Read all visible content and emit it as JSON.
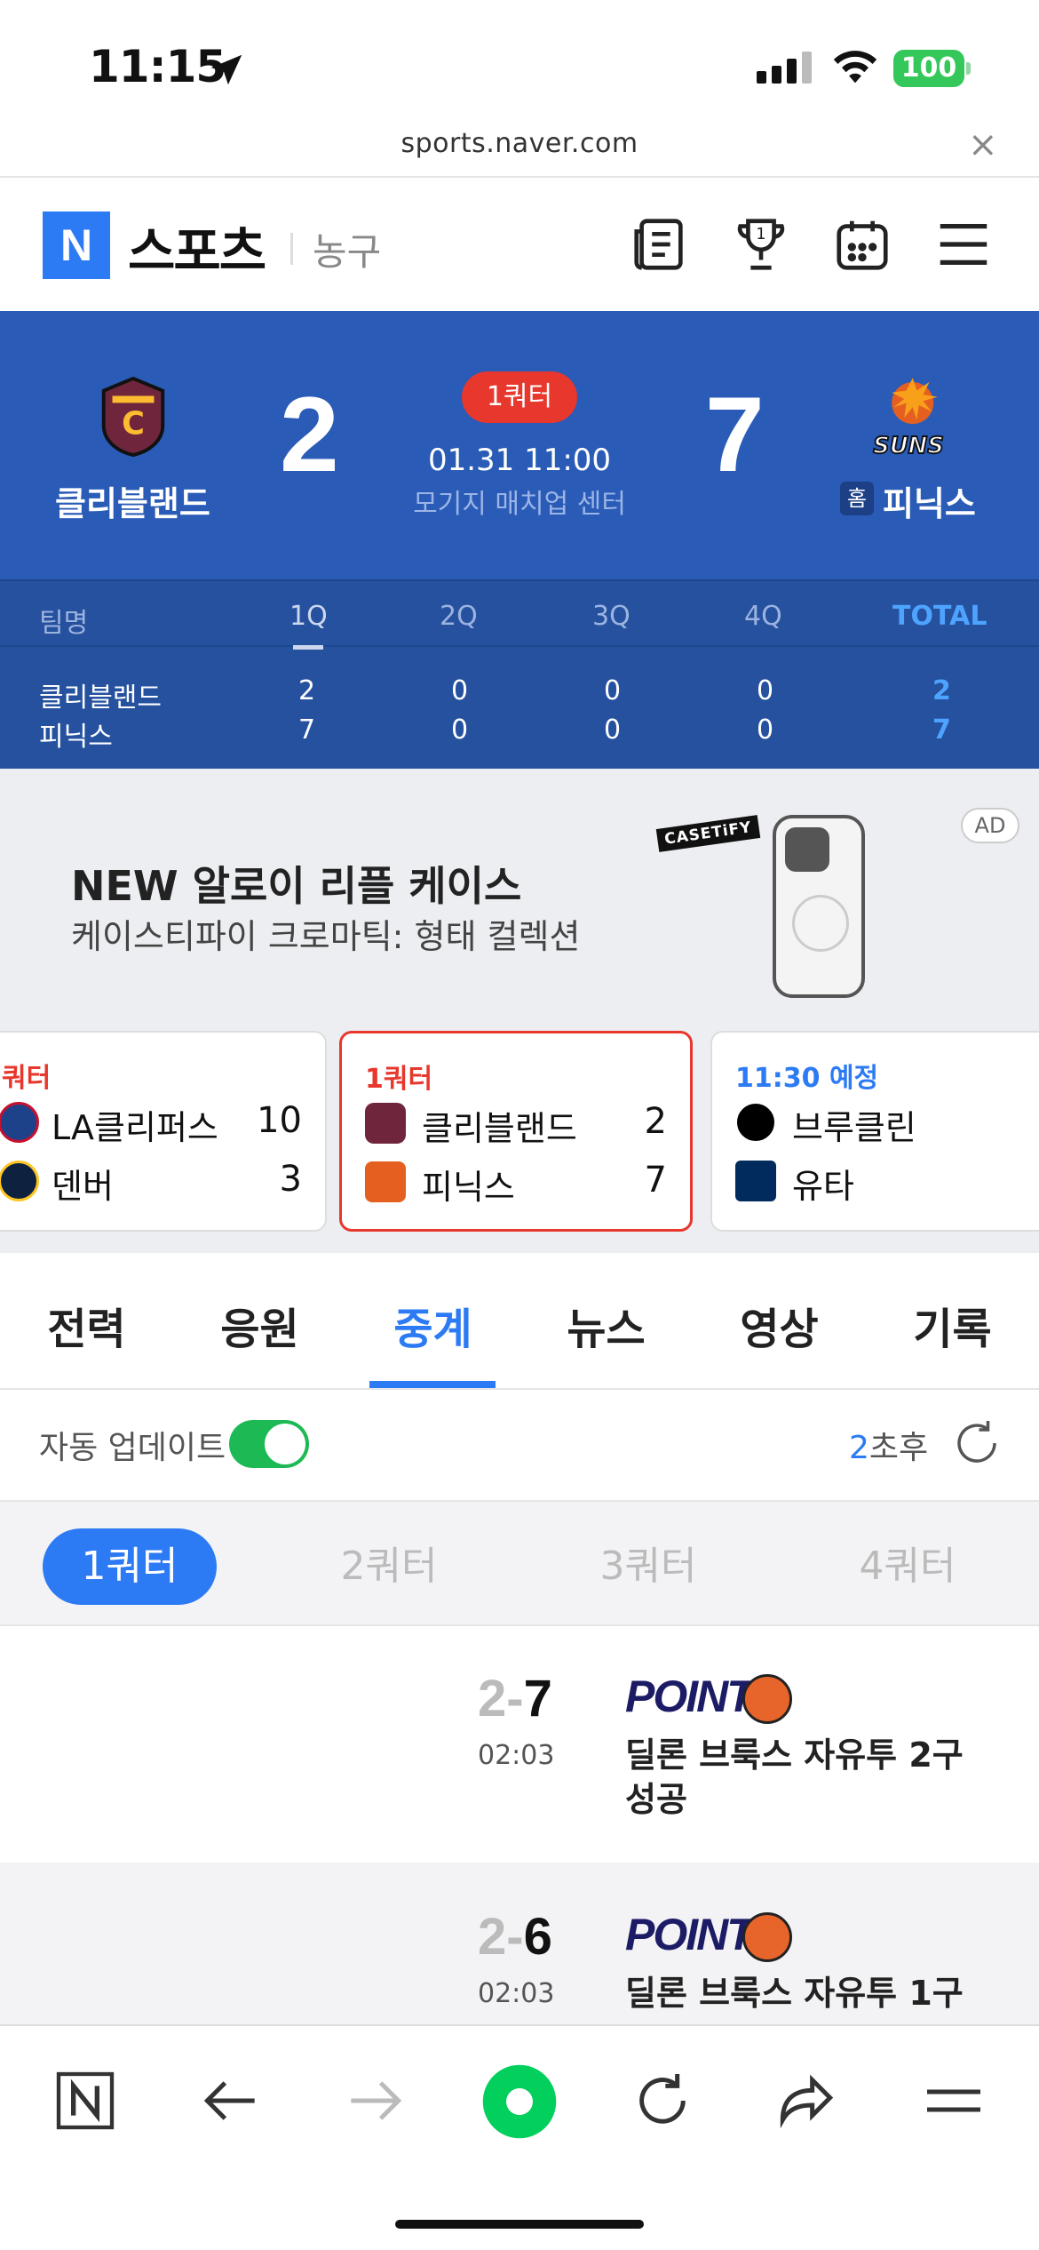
{
  "status_bar": {
    "time": "11:15",
    "battery": "100"
  },
  "browser": {
    "url": "sports.naver.com",
    "close": "×"
  },
  "header": {
    "logo": "N",
    "brand": "스포츠",
    "section": "농구"
  },
  "game": {
    "home": {
      "name": "클리블랜드",
      "score": "2"
    },
    "away": {
      "name": "피닉스",
      "score": "7",
      "home_badge": "홈"
    },
    "status": "1쿼터",
    "datetime": "01.31 11:00",
    "venue": "모기지 매치업 센터"
  },
  "quarter_table": {
    "headers": [
      "팀명",
      "1Q",
      "2Q",
      "3Q",
      "4Q",
      "TOTAL"
    ],
    "rows": [
      {
        "team": "클리블랜드",
        "q": [
          "2",
          "0",
          "0",
          "0"
        ],
        "total": "2"
      },
      {
        "team": "피닉스",
        "q": [
          "7",
          "0",
          "0",
          "0"
        ],
        "total": "7"
      }
    ]
  },
  "ad": {
    "title": "NEW 알로이 리플 케이스",
    "subtitle": "케이스티파이 크로마틱: 형태 컬렉션",
    "badge": "AD",
    "brand": "CASETiFY"
  },
  "game_cards": [
    {
      "status": "쿼터",
      "t1": "LA클리퍼스",
      "s1": "10",
      "t2": "덴버",
      "s2": "3"
    },
    {
      "status": "1쿼터",
      "t1": "클리블랜드",
      "s1": "2",
      "t2": "피닉스",
      "s2": "7"
    },
    {
      "status": "11:30 예정",
      "t1": "브루클린",
      "s1": "",
      "t2": "유타",
      "s2": ""
    }
  ],
  "tabs": [
    "전력",
    "응원",
    "중계",
    "뉴스",
    "영상",
    "기록"
  ],
  "auto_update": {
    "label": "자동 업데이트",
    "countdown_num": "2",
    "countdown_text": "초후"
  },
  "quarter_tabs": [
    "1쿼터",
    "2쿼터",
    "3쿼터",
    "4쿼터"
  ],
  "events": [
    {
      "away_score": "2",
      "sep": "-",
      "home_score": "7",
      "time": "02:03",
      "tag": "POINT!",
      "desc": "딜론 브룩스 자유투 2구 성공"
    },
    {
      "away_score": "2",
      "sep": "-",
      "home_score": "6",
      "time": "02:03",
      "tag": "POINT!",
      "desc": "딜론 브룩스 자유투 1구"
    }
  ],
  "colors": {
    "accent": "#2d7bf4",
    "scoreboard": "#2a5bb7",
    "live": "#e8372c",
    "toggle_on": "#1db954"
  }
}
